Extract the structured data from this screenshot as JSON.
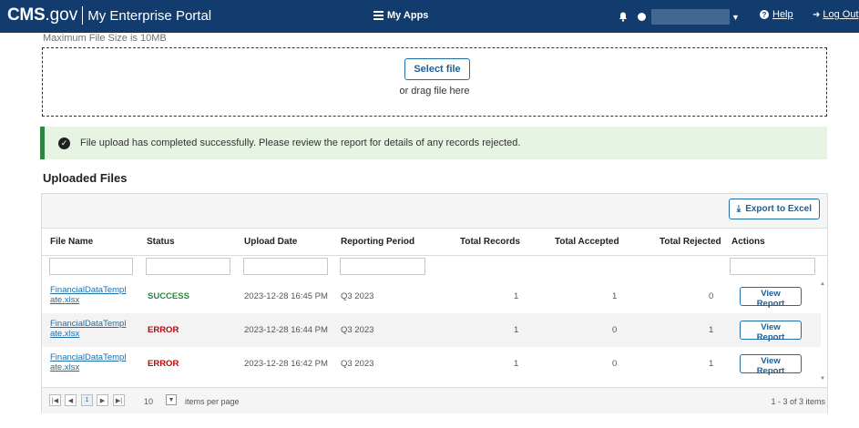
{
  "header": {
    "logo_brand": "CMS",
    "logo_suffix": ".gov",
    "portal_name": "My Enterprise Portal",
    "my_apps_label": "My Apps",
    "help_label": "Help",
    "logout_label": "Log Out"
  },
  "upload": {
    "max_size_text": "Maximum File Size is 10MB",
    "select_label": "Select file",
    "drag_text": "or drag file here"
  },
  "alert": {
    "message": "File upload has completed successfully. Please review the report for details of any records rejected."
  },
  "uploaded_files": {
    "title": "Uploaded Files",
    "export_label": "Export to Excel",
    "columns": [
      "File Name",
      "Status",
      "Upload Date",
      "Reporting Period",
      "Total Records",
      "Total Accepted",
      "Total Rejected",
      "Actions"
    ],
    "rows": [
      {
        "file_line1": "FinancialDataTempl",
        "file_line2": "ate.xlsx",
        "status": "SUCCESS",
        "upload_date": "2023-12-28 16:45 PM",
        "period": "Q3 2023",
        "total": "1",
        "accepted": "1",
        "rejected": "0",
        "action": "View Report"
      },
      {
        "file_line1": "FinancialDataTempl",
        "file_line2": "ate.xlsx",
        "status": "ERROR",
        "upload_date": "2023-12-28 16:44 PM",
        "period": "Q3 2023",
        "total": "1",
        "accepted": "0",
        "rejected": "1",
        "action": "View Report"
      },
      {
        "file_line1": "FinancialDataTempl",
        "file_line2": "ate.xlsx",
        "status": "ERROR",
        "upload_date": "2023-12-28 16:42 PM",
        "period": "Q3 2023",
        "total": "1",
        "accepted": "0",
        "rejected": "1",
        "action": "View Report"
      }
    ],
    "pager": {
      "current_page": "1",
      "page_size": "10",
      "items_per_page_label": "items per page",
      "count_text": "1 - 3 of 3 items"
    }
  },
  "colors": {
    "header_bg": "#133c6e",
    "success": "#2e8540",
    "error": "#b50909",
    "link": "#1f6ea7"
  }
}
